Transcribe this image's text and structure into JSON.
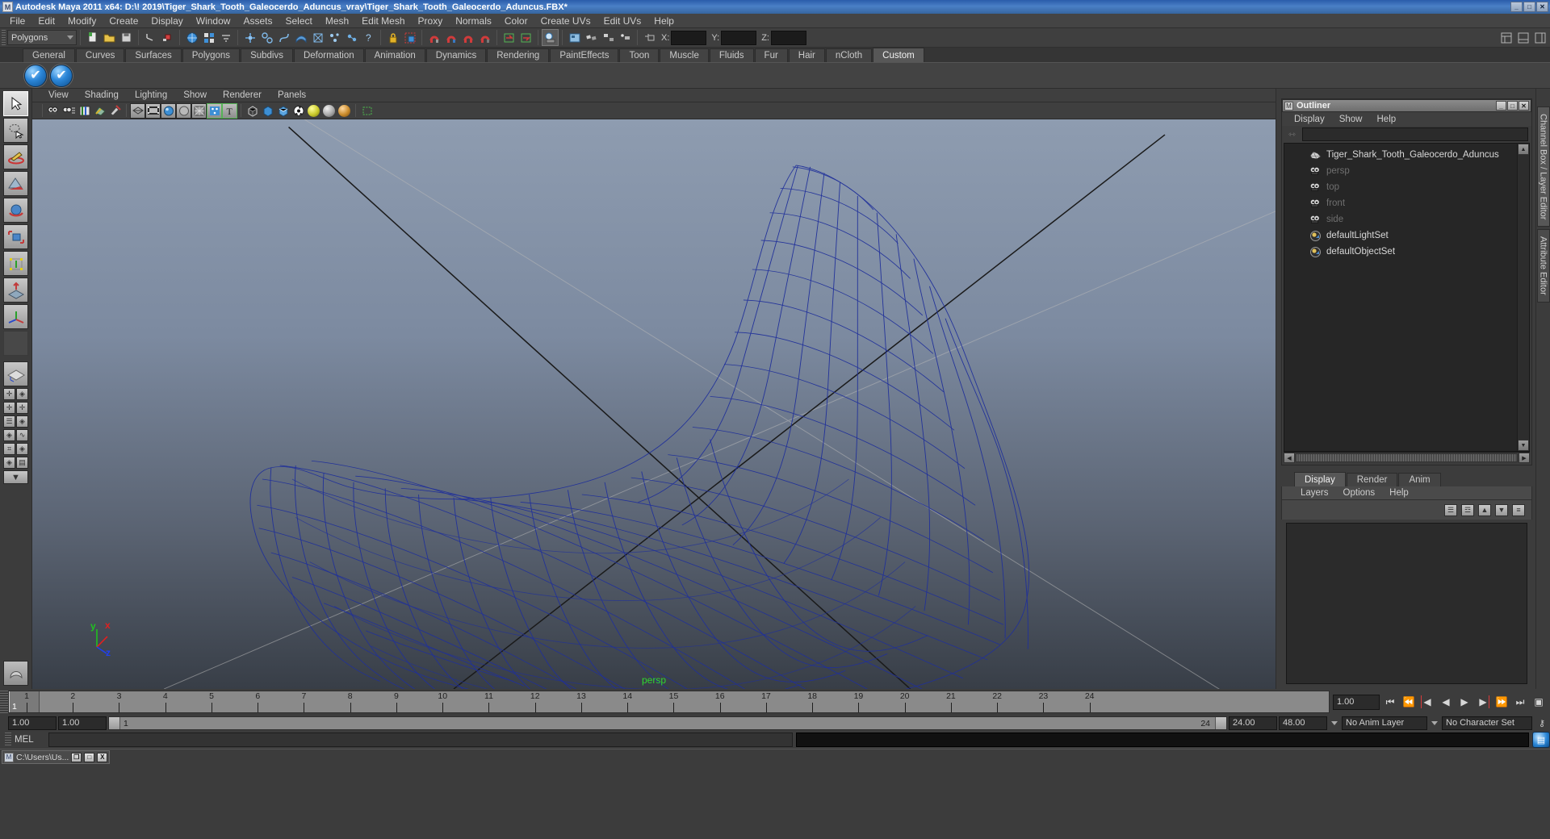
{
  "titlebar": {
    "icon": "maya-logo-icon",
    "text": "Autodesk Maya 2011 x64: D:\\! 2019\\Tiger_Shark_Tooth_Galeocerdo_Aduncus_vray\\Tiger_Shark_Tooth_Galeocerdo_Aduncus.FBX*",
    "minimize": "_",
    "maximize": "□",
    "close": "✕"
  },
  "menubar": {
    "items": [
      "File",
      "Edit",
      "Modify",
      "Create",
      "Display",
      "Window",
      "Assets",
      "Select",
      "Mesh",
      "Edit Mesh",
      "Proxy",
      "Normals",
      "Color",
      "Create UVs",
      "Edit UVs",
      "Help"
    ]
  },
  "statusline": {
    "selection_mode": "Polygons",
    "axis_labels": [
      "X:",
      "Y:",
      "Z:"
    ],
    "axis_values": [
      "",
      "",
      ""
    ],
    "icons": [
      "new-scene-icon",
      "open-scene-icon",
      "save-scene-icon",
      "undo-icon",
      "redo-icon",
      "select-by-hierarchy-icon",
      "select-by-object-icon",
      "select-by-component-icon",
      "handles-icon",
      "pivots-icon",
      "curve-icon",
      "surface-icon",
      "deformer-icon",
      "dynamics-icon",
      "misc-icon",
      "help-icon",
      "lock-selection-icon",
      "highlight-selection-icon",
      "snap-grid-icon",
      "snap-curve-icon",
      "snap-point-icon",
      "snap-view-plane-icon",
      "snap-live-icon",
      "make-live-icon",
      "construction-history-icon",
      "render-current-frame-icon",
      "ipr-render-icon",
      "render-settings-icon",
      "hypershade-icon",
      "render-view-icon",
      "light-icon",
      "show-manipulator-icon"
    ],
    "right_icons": [
      "show-hide-channel-box-icon",
      "show-hide-layer-editor-icon",
      "show-hide-attribute-editor-icon"
    ]
  },
  "shelf": {
    "tabs": [
      "General",
      "Curves",
      "Surfaces",
      "Polygons",
      "Subdivs",
      "Deformation",
      "Animation",
      "Dynamics",
      "Rendering",
      "PaintEffects",
      "Toon",
      "Muscle",
      "Fluids",
      "Fur",
      "Hair",
      "nCloth",
      "Custom"
    ],
    "active_tab": "Custom",
    "buttons": [
      "blue-check-icon",
      "blue-check-icon"
    ],
    "button_glyph": "✔"
  },
  "toolbox": {
    "tools": [
      {
        "name": "select-tool",
        "glyph": "➤",
        "selected": true
      },
      {
        "name": "lasso-select-tool",
        "glyph": "❀",
        "selected": false
      },
      {
        "name": "paint-select-tool",
        "glyph": "✎",
        "selected": false
      },
      {
        "name": "move-tool",
        "glyph": "◢",
        "selected": false
      },
      {
        "name": "rotate-tool",
        "glyph": "●",
        "selected": false
      },
      {
        "name": "scale-tool",
        "glyph": "▣",
        "selected": false
      },
      {
        "name": "universal-manipulator-tool",
        "glyph": "✣",
        "selected": false
      },
      {
        "name": "soft-modification-tool",
        "glyph": "⬆",
        "selected": false
      },
      {
        "name": "show-manipulator-tool",
        "glyph": "✥",
        "selected": false
      },
      {
        "name": "last-tool-used",
        "glyph": "",
        "selected": false
      }
    ],
    "layouts": [
      {
        "name": "single-perspective-view-layout",
        "glyph": "◈"
      },
      {
        "name": "four-view-layout",
        "glyph": "⊞"
      },
      {
        "name": "two-pane-side-layout",
        "glyph": "▥"
      },
      {
        "name": "two-pane-stacked-layout",
        "glyph": "▤"
      },
      {
        "name": "outliner-persp-layout",
        "glyph": "☰"
      },
      {
        "name": "persp-graph-layout",
        "glyph": "◈"
      },
      {
        "name": "hypershade-persp-layout",
        "glyph": "⌗"
      },
      {
        "name": "persp-render-layout",
        "glyph": "▨"
      }
    ],
    "expand_glyph": "▼",
    "logo": "maya-logo-icon"
  },
  "viewport": {
    "menu": [
      "View",
      "Shading",
      "Lighting",
      "Show",
      "Renderer",
      "Panels"
    ],
    "toolbar_icons": [
      "select-camera-icon",
      "camera-attributes-icon",
      "book-icon",
      "image-plane-icon",
      "paint-icon",
      "wireframe-icon",
      "film-gate-icon",
      "smooth-shade-icon",
      "flat-shade-icon",
      "wireframe-on-shaded-icon",
      "texture-icon",
      "text-icon",
      "xray-icon",
      "xray-joints-icon",
      "shadows-icon",
      "checker-icon",
      "default-light-icon",
      "all-lights-icon",
      "scene-lights-icon",
      "iso-select-icon"
    ],
    "camera_label": "persp",
    "axis_x": "x",
    "axis_y": "y",
    "axis_z": "z",
    "axis_x_color": "#e02020",
    "axis_y_color": "#20c020",
    "axis_z_color": "#2040ef",
    "mesh_color": "#1f2e8c",
    "bg_top": "#8e9cb0",
    "bg_bottom": "#3a4049"
  },
  "outliner": {
    "title": "Outliner",
    "window_buttons": [
      "_",
      "□",
      "✕"
    ],
    "menu": [
      "Display",
      "Show",
      "Help"
    ],
    "search_value": "",
    "items": [
      {
        "label": "Tiger_Shark_Tooth_Galeocerdo_Aduncus",
        "icon": "mesh-icon",
        "dim": false
      },
      {
        "label": "persp",
        "icon": "camera-icon",
        "dim": true
      },
      {
        "label": "top",
        "icon": "camera-icon",
        "dim": true
      },
      {
        "label": "front",
        "icon": "camera-icon",
        "dim": true
      },
      {
        "label": "side",
        "icon": "camera-icon",
        "dim": true
      },
      {
        "label": "defaultLightSet",
        "icon": "set-icon",
        "dim": false
      },
      {
        "label": "defaultObjectSet",
        "icon": "set-icon",
        "dim": false
      }
    ],
    "scroll_up": "▲",
    "scroll_down": "▼",
    "scroll_left": "◀",
    "scroll_right": "▶"
  },
  "layer_editor": {
    "tabs": [
      "Display",
      "Render",
      "Anim"
    ],
    "active_tab": "Display",
    "menu": [
      "Layers",
      "Options",
      "Help"
    ],
    "buttons": [
      "new-layer-icon",
      "new-layer-from-selected-icon",
      "move-layer-up-icon",
      "move-layer-down-icon",
      "layer-options-icon"
    ],
    "button_glyphs": [
      "☰",
      "☲",
      "▲",
      "▼",
      "≡"
    ]
  },
  "side_tabs": [
    {
      "label": "Channel Box / Layer Editor",
      "active": true
    },
    {
      "label": "Attribute Editor",
      "active": false
    }
  ],
  "timeline": {
    "start": 1,
    "end": 24,
    "ticks": [
      1,
      2,
      3,
      4,
      5,
      6,
      7,
      8,
      9,
      10,
      11,
      12,
      13,
      14,
      15,
      16,
      17,
      18,
      19,
      20,
      21,
      22,
      23,
      24
    ],
    "current_frame": "1",
    "current_frame_field": "1.00",
    "playback_buttons": [
      {
        "name": "go-to-start-button",
        "glyph": "⏮"
      },
      {
        "name": "step-back-keyframe-button",
        "glyph": "⏪"
      },
      {
        "name": "step-back-frame-button",
        "glyph": "◀❘"
      },
      {
        "name": "play-backwards-button",
        "glyph": "◀"
      },
      {
        "name": "play-forwards-button",
        "glyph": "▶"
      },
      {
        "name": "step-forward-frame-button",
        "glyph": "❘▶"
      },
      {
        "name": "step-forward-keyframe-button",
        "glyph": "⏩"
      },
      {
        "name": "go-to-end-button",
        "glyph": "⏭"
      }
    ]
  },
  "rangebar": {
    "start_field": "1.00",
    "end_field": "1.00",
    "range_in": "1",
    "range_out": "24",
    "playback_start": "24.00",
    "playback_end": "48.00",
    "anim_layer": "No Anim Layer",
    "character_set": "No Character Set",
    "key_icon": "key-icon"
  },
  "melbar": {
    "label": "MEL",
    "input_value": "",
    "output_value": "",
    "script_editor_icon": "script-editor-icon"
  },
  "taskbar": {
    "button_icon": "maya-logo-icon",
    "button_label": "C:\\Users\\Us...",
    "restore": "❐",
    "maximize": "□",
    "close": "X"
  }
}
